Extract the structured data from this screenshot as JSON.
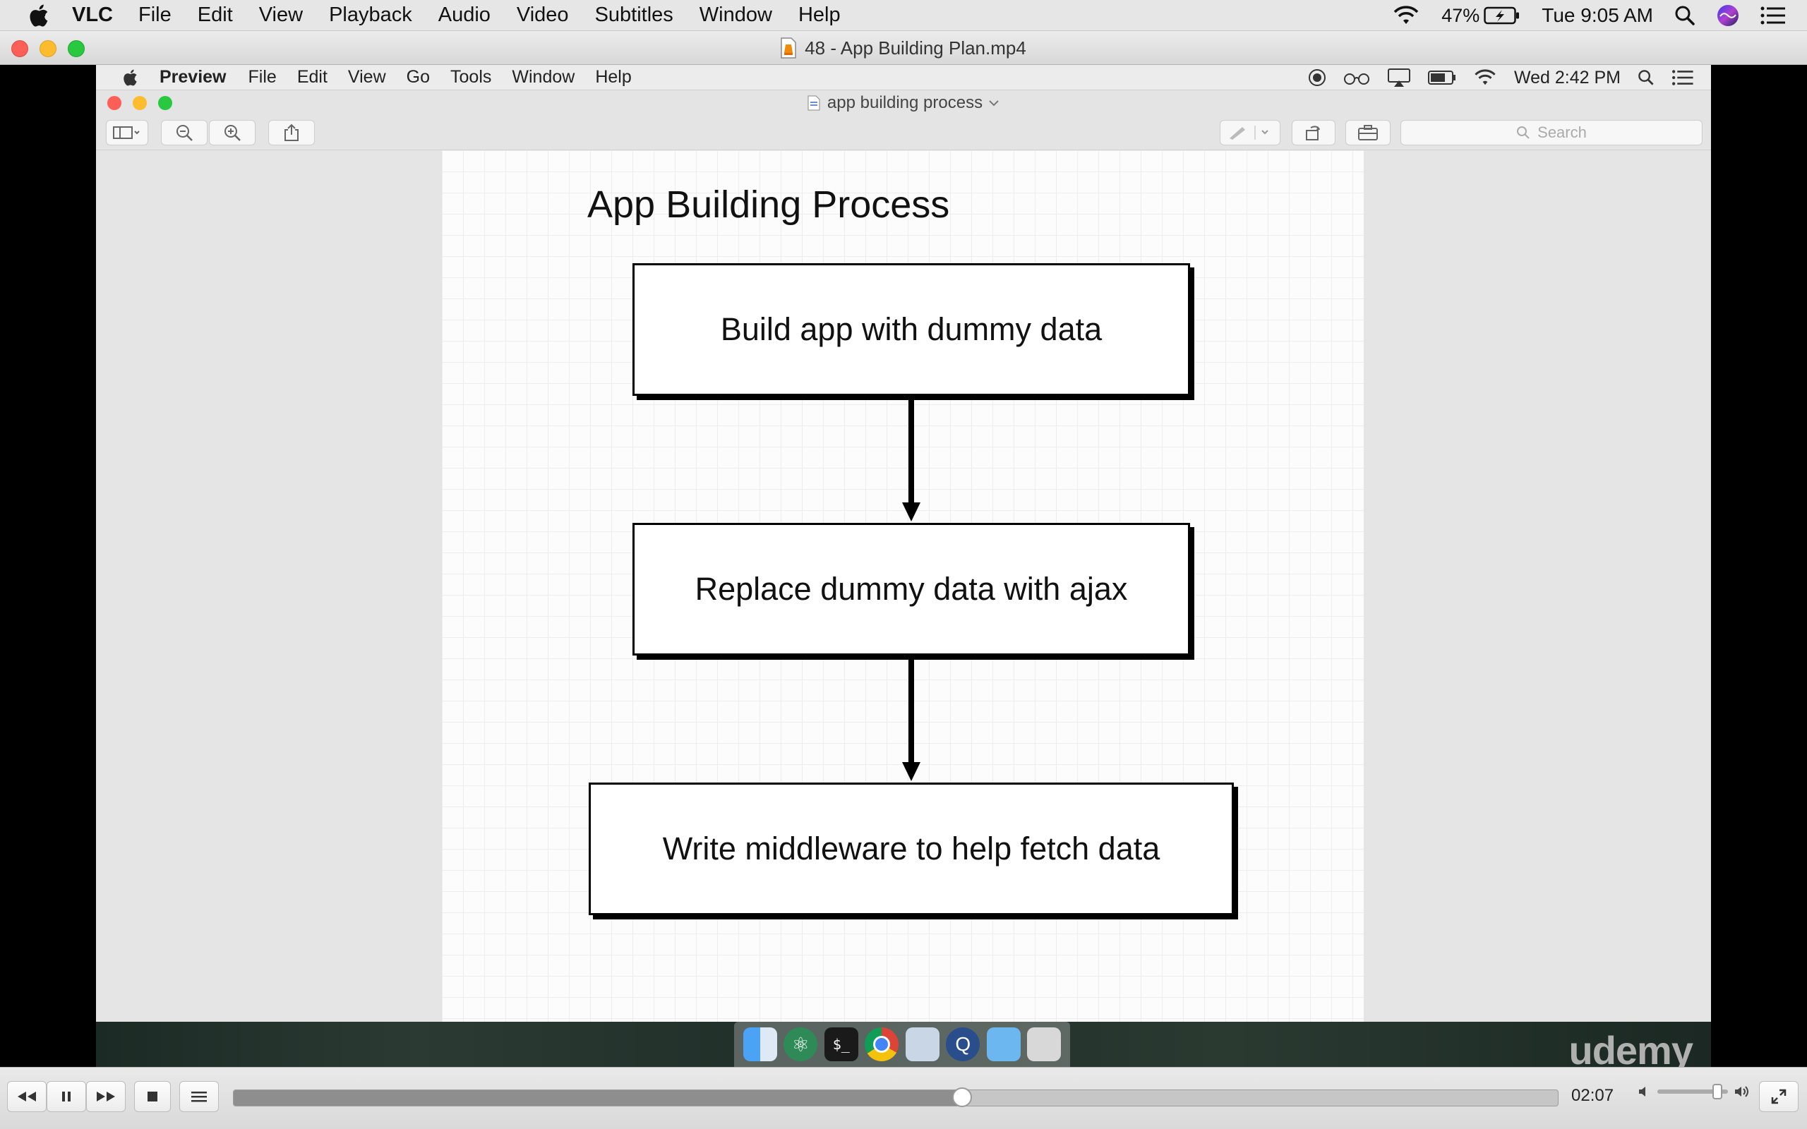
{
  "menubar": {
    "app": "VLC",
    "items": [
      "File",
      "Edit",
      "View",
      "Playback",
      "Audio",
      "Video",
      "Subtitles",
      "Window",
      "Help"
    ],
    "battery": "47%",
    "clock": "Tue 9:05 AM",
    "icons": [
      "apple-icon",
      "wifi-icon",
      "battery-icon",
      "spotlight-icon",
      "siri-icon",
      "notification-center-icon"
    ]
  },
  "window": {
    "title": "48 - App Building Plan.mp4"
  },
  "video": {
    "menubar": {
      "app": "Preview",
      "items": [
        "File",
        "Edit",
        "View",
        "Go",
        "Tools",
        "Window",
        "Help"
      ],
      "clock": "Wed 2:42 PM"
    },
    "preview": {
      "doc_title": "app building process",
      "search_placeholder": "Search"
    },
    "diagram": {
      "title": "App Building Process",
      "steps": [
        "Build app with dummy data",
        "Replace dummy data with ajax",
        "Write middleware to help fetch data"
      ]
    },
    "watermark": "udemy"
  },
  "controls": {
    "time": "02:07",
    "progress": 0.55,
    "volume": 0.85
  }
}
